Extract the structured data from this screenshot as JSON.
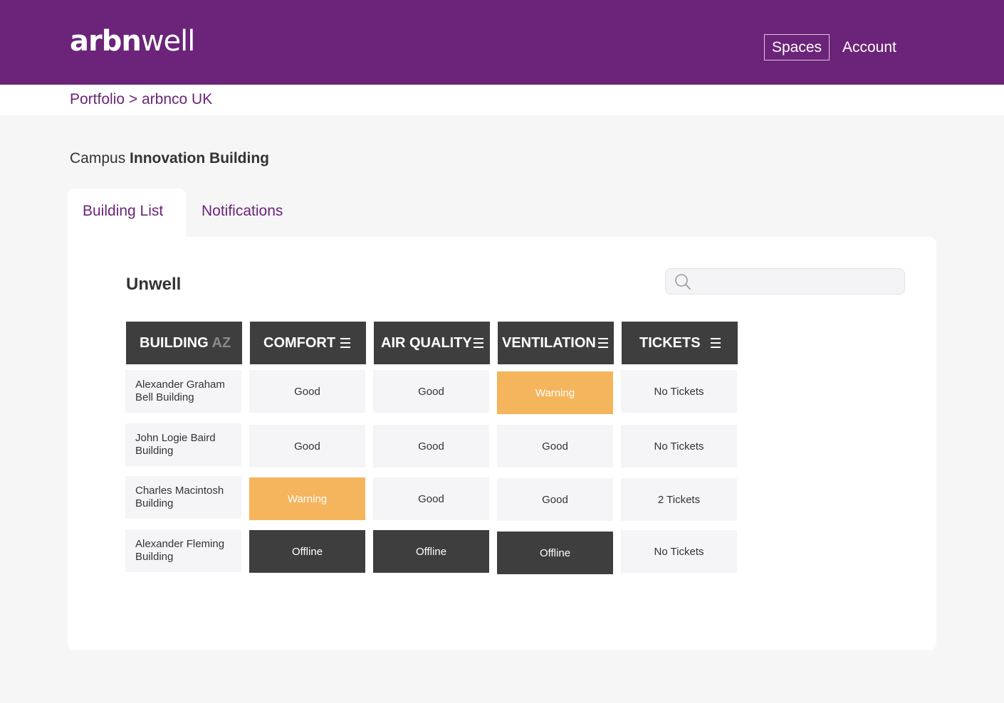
{
  "header": {
    "logo_bold": "arbn",
    "logo_light": "well",
    "nav": {
      "spaces": "Spaces",
      "account": "Account"
    }
  },
  "breadcrumb": {
    "portfolio": "Portfolio",
    "separator": " > ",
    "current": "arbnco UK"
  },
  "page": {
    "title_prefix": "Campus ",
    "title_strong": "Innovation Building"
  },
  "tabs": [
    {
      "label": "Building List",
      "active": true
    },
    {
      "label": "Notifications",
      "active": false
    }
  ],
  "panel": {
    "title": "Unwell",
    "search": {
      "placeholder": "",
      "value": ""
    }
  },
  "table": {
    "columns": [
      {
        "label": "BUILDING",
        "sort": "AZ"
      },
      {
        "label": "COMFORT",
        "icon": "menu-icon"
      },
      {
        "label": "AIR QUALITY",
        "icon": "menu-icon"
      },
      {
        "label": "VENTILATION",
        "icon": "menu-icon"
      },
      {
        "label": "TICKETS",
        "icon": "menu-icon"
      }
    ],
    "rows": [
      {
        "building": "Alexander Graham Bell Building",
        "comfort": "Good",
        "air_quality": "Good",
        "ventilation": "Warning",
        "tickets": "No Tickets"
      },
      {
        "building": "John Logie Baird Building",
        "comfort": "Good",
        "air_quality": "Good",
        "ventilation": "Good",
        "tickets": "No Tickets"
      },
      {
        "building": "Charles Macintosh Building",
        "comfort": "Warning",
        "air_quality": "Good",
        "ventilation": "Good",
        "tickets": "2 Tickets"
      },
      {
        "building": "Alexander Fleming Building",
        "comfort": "Offline",
        "air_quality": "Offline",
        "ventilation": "Offline",
        "tickets": "No Tickets"
      }
    ]
  },
  "colors": {
    "brand_purple": "#6b2479",
    "header_dark": "#3e3e3e",
    "warning": "#f5b55c",
    "offline": "#3e3e3e",
    "good_cell": "#f5f5f7"
  }
}
